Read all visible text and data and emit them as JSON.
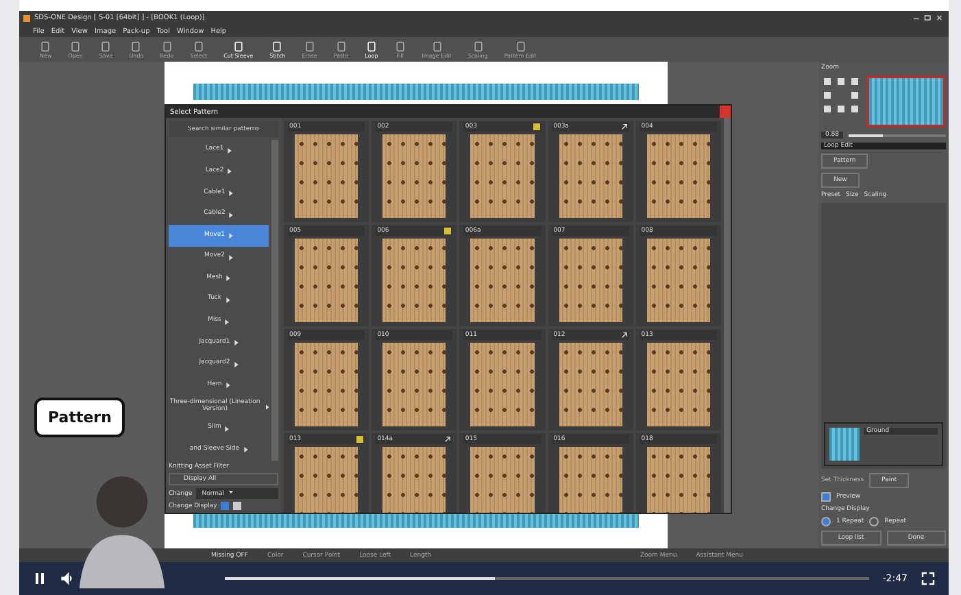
{
  "window": {
    "title": "SDS-ONE Design [ S-01 [64bit] ] - [BOOK1 (Loop)]"
  },
  "menu": [
    "File",
    "Edit",
    "View",
    "Image",
    "Pack-up",
    "Tool",
    "Window",
    "Help"
  ],
  "toolbar": [
    {
      "label": "New",
      "disabled": true
    },
    {
      "label": "Open",
      "disabled": true
    },
    {
      "label": "Save",
      "disabled": true
    },
    {
      "label": "Undo",
      "disabled": true
    },
    {
      "label": "Redo",
      "disabled": true
    },
    {
      "label": "Select",
      "disabled": true
    },
    {
      "label": "Cut Sleeve",
      "disabled": false
    },
    {
      "label": "Stitch",
      "disabled": false
    },
    {
      "label": "Erase",
      "disabled": true
    },
    {
      "label": "Paste",
      "disabled": true
    },
    {
      "label": "Loop",
      "disabled": false
    },
    {
      "label": "Fill",
      "disabled": true
    },
    {
      "label": "Image Edit",
      "disabled": true
    },
    {
      "label": "Scaling",
      "disabled": true
    },
    {
      "label": "Pattern Edit",
      "disabled": true
    }
  ],
  "dialog": {
    "title": "Select Pattern",
    "search": {
      "placeholder": "Search similar patterns"
    },
    "categories": [
      {
        "label": "Lace1",
        "selected": false
      },
      {
        "label": "Lace2",
        "selected": false
      },
      {
        "label": "Cable1",
        "selected": false
      },
      {
        "label": "Cable2",
        "selected": false
      },
      {
        "label": "Move1",
        "selected": true
      },
      {
        "label": "Move2",
        "selected": false
      },
      {
        "label": "Mesh",
        "selected": false
      },
      {
        "label": "Tuck",
        "selected": false
      },
      {
        "label": "Miss",
        "selected": false
      },
      {
        "label": "Jacquard1",
        "selected": false
      },
      {
        "label": "Jacquard2",
        "selected": false
      },
      {
        "label": "Hem",
        "selected": false
      },
      {
        "label": "Three-dimensional (Lineation Version)",
        "selected": false
      },
      {
        "label": "Slim",
        "selected": false
      },
      {
        "label": "and Sleeve Side",
        "selected": false
      }
    ],
    "filter_label": "Knitting Asset Filter",
    "filter_value": "Display All",
    "change_label": "Change",
    "change_value": "Normal",
    "display_label": "Change Display",
    "patterns": [
      {
        "code": "001",
        "flagged": false,
        "linked": false
      },
      {
        "code": "002",
        "flagged": false,
        "linked": false
      },
      {
        "code": "003",
        "flagged": true,
        "linked": false
      },
      {
        "code": "003a",
        "flagged": false,
        "linked": true
      },
      {
        "code": "004",
        "flagged": false,
        "linked": false
      },
      {
        "code": "005",
        "flagged": false,
        "linked": false
      },
      {
        "code": "006",
        "flagged": true,
        "linked": false
      },
      {
        "code": "006a",
        "flagged": false,
        "linked": false
      },
      {
        "code": "007",
        "flagged": false,
        "linked": false
      },
      {
        "code": "008",
        "flagged": false,
        "linked": false
      },
      {
        "code": "009",
        "flagged": false,
        "linked": false
      },
      {
        "code": "010",
        "flagged": false,
        "linked": false
      },
      {
        "code": "011",
        "flagged": false,
        "linked": false
      },
      {
        "code": "012",
        "flagged": false,
        "linked": true
      },
      {
        "code": "013",
        "flagged": false,
        "linked": false
      },
      {
        "code": "013",
        "flagged": true,
        "linked": false
      },
      {
        "code": "014a",
        "flagged": false,
        "linked": true
      },
      {
        "code": "015",
        "flagged": false,
        "linked": false
      },
      {
        "code": "016",
        "flagged": false,
        "linked": false
      },
      {
        "code": "018",
        "flagged": false,
        "linked": false
      }
    ]
  },
  "panel": {
    "zoom_label": "Zoom",
    "zoom_value": "0.88",
    "zoom_slider": {
      "level": 0.35
    },
    "loop_edit_label": "Loop Edit",
    "pattern_button": "Pattern",
    "new_button": "New",
    "preset_label": "Preset",
    "size_label": "Size",
    "scaling_label": "Scaling",
    "layer": "Ground",
    "thickness_label": "Set Thickness",
    "paint_button": "Paint",
    "preview": {
      "label": "Preview",
      "checked": true
    },
    "display_label": "Change Display",
    "repeat_options": [
      {
        "label": "1 Repeat",
        "selected": true
      },
      {
        "label": "Repeat",
        "selected": false
      }
    ],
    "loop_list_button": "Loop list",
    "done_button": "Done"
  },
  "status_bar": {
    "missing": "Missing OFF",
    "items": [
      "Color",
      "Cursor Point",
      "Loose Left",
      "Length"
    ],
    "menus": [
      "Zoom Menu",
      "Assistant Menu"
    ]
  },
  "overlay": {
    "caption": "Pattern"
  },
  "player": {
    "level": 0.42,
    "time": "-2:47"
  }
}
